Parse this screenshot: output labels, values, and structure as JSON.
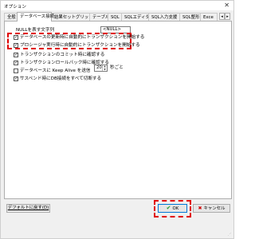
{
  "window": {
    "title": "オプション",
    "close_glyph": "✕"
  },
  "tabs": [
    {
      "label": "全般",
      "active": false
    },
    {
      "label": "データベース接続",
      "active": true
    },
    {
      "label": "結果セットグリッド",
      "active": false
    },
    {
      "label": "テーブル",
      "active": false
    },
    {
      "label": "SQL",
      "active": false
    },
    {
      "label": "SQLエディタ",
      "active": false
    },
    {
      "label": "SQL入力支援",
      "active": false
    },
    {
      "label": "SQL整形",
      "active": false
    },
    {
      "label": "Exce",
      "active": false
    }
  ],
  "tab_scroll": {
    "left": "◂",
    "right": "▸"
  },
  "null_setting": {
    "label": "NULLを表す文字列",
    "value": "<NULL>"
  },
  "options": [
    {
      "label": "データベースの更新時に自動的にトランザクションを開始する",
      "checked": true
    },
    {
      "label": "プロシージャ実行時に自動的にトランザクションを開始する",
      "checked": true
    },
    {
      "label": "トランザクションのコミット時に確認する",
      "checked": true
    },
    {
      "label": "トランザクションロールバック時に確認する",
      "checked": true
    },
    {
      "label": "データベースに Keep Alive を送信",
      "checked": false
    },
    {
      "label": "サスペンド時にDB接続をすべて切断する",
      "checked": true
    }
  ],
  "keepalive": {
    "value": "20",
    "unit": "秒ごと",
    "spin_up": "▲",
    "spin_down": "▼"
  },
  "check_glyph": "✓",
  "buttons": {
    "default_label": "デフォルトに戻す(D)",
    "ok_label": "OK",
    "ok_icon": "✔",
    "cancel_label": "キャンセル",
    "cancel_icon": "✖"
  },
  "colors": {
    "highlight": "#e00000",
    "ok_icon": "#1e9e28",
    "cancel_icon": "#d00000",
    "panel_bg": "#ffffff",
    "window_bg": "#f0f0f0"
  }
}
